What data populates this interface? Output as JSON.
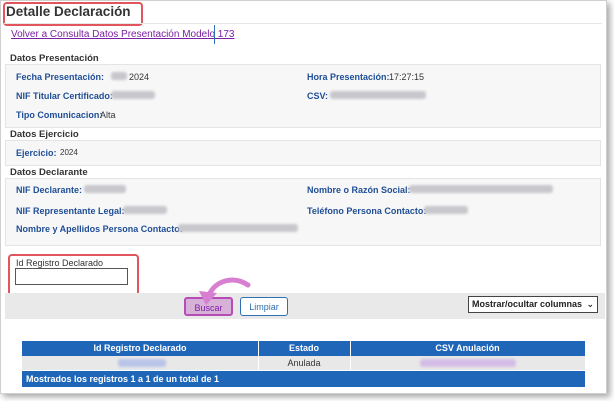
{
  "page": {
    "title": "Detalle Declaración",
    "back_link": "Volver a Consulta Datos Presentación Modelo 173"
  },
  "presentacion": {
    "section_title": "Datos Presentación",
    "fecha_label": "Fecha Presentación:",
    "fecha_value": "2024",
    "hora_label": "Hora Presentación:",
    "hora_value": "17:27:15",
    "nif_label": "NIF Titular Certificado:",
    "csv_label": "CSV:",
    "tipo_label": "Tipo Comunicacion:",
    "tipo_value": "Alta"
  },
  "ejercicio": {
    "section_title": "Datos Ejercicio",
    "label": "Ejercicio:",
    "value": "2024"
  },
  "declarante": {
    "section_title": "Datos Declarante",
    "nif_label": "NIF Declarante:",
    "nombre_label": "Nombre o Razón Social:",
    "nif_rep_label": "NIF Representante Legal:",
    "telefono_label": "Teléfono Persona Contacto:",
    "contacto_label": "Nombre y Apellidos Persona Contacto:"
  },
  "search": {
    "label": "Id Registro Declarado",
    "value": ""
  },
  "toolbar": {
    "buscar": "Buscar",
    "limpiar": "Limpiar",
    "columns_select": "Mostrar/ocultar columnas"
  },
  "table": {
    "headers": [
      "Id Registro Declarado",
      "Estado",
      "CSV Anulación"
    ],
    "rows": [
      {
        "estado": "Anulada"
      }
    ],
    "footer": "Mostrados los registros 1 a 1 de un total de 1"
  },
  "colors": {
    "highlight": "#e0565c",
    "header_blue": "#1f66b8",
    "label_blue": "#1f4e96",
    "link_purple": "#7a1fa2",
    "arrow_pink": "#d77fd0"
  },
  "icons": {
    "select_chevron": "chevron-down-icon",
    "annotation_arrow": "curved-arrow-icon"
  }
}
